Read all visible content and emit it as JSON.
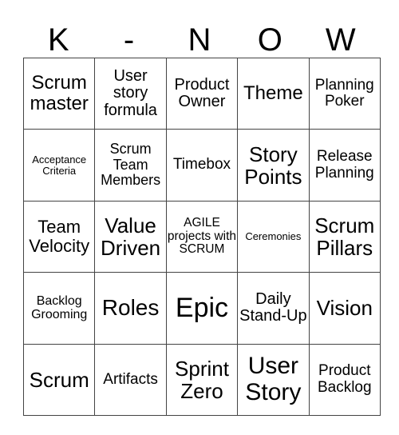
{
  "header": {
    "letters": [
      "K",
      "-",
      "N",
      "O",
      "W"
    ]
  },
  "board": {
    "rows": [
      [
        "Scrum master",
        "User story formula",
        "Product Owner",
        "Theme",
        "Planning Poker"
      ],
      [
        "Acceptance Criteria",
        "Scrum Team Members",
        "Timebox",
        "Story Points",
        "Release Planning"
      ],
      [
        "Team Velocity",
        "Value Driven",
        "AGILE projects with SCRUM",
        "Ceremonies",
        "Scrum Pillars"
      ],
      [
        "Backlog Grooming",
        "Roles",
        "Epic",
        "Daily Stand-Up",
        "Vision"
      ],
      [
        "Scrum",
        "Artifacts",
        "Sprint Zero",
        "User Story",
        "Product Backlog"
      ]
    ]
  }
}
